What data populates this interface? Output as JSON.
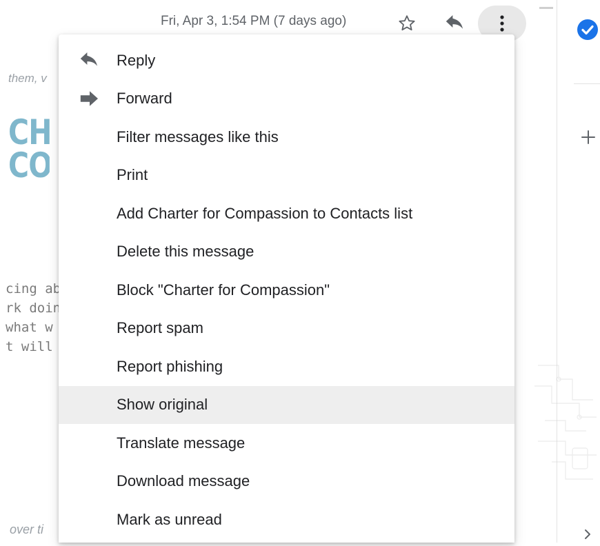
{
  "header": {
    "timestamp": "Fri, Apr 3, 1:54 PM (7 days ago)"
  },
  "icons": {
    "star": "star-outline-icon",
    "reply": "reply-icon",
    "more": "more-vertical-icon",
    "forward": "forward-icon",
    "tasks": "tasks-check-icon",
    "add": "plus-icon",
    "expand": "chevron-right-icon"
  },
  "background": {
    "fragment_top": "them, v",
    "logo_line1": "CH",
    "logo_line2": "CO",
    "body_lines": [
      "cing ab",
      "rk doin",
      " what w",
      "t will l"
    ],
    "fragment_bottom": "over ti"
  },
  "menu": {
    "items": [
      {
        "label": "Reply",
        "icon": "reply-icon"
      },
      {
        "label": "Forward",
        "icon": "forward-icon"
      },
      {
        "label": "Filter messages like this"
      },
      {
        "label": "Print"
      },
      {
        "label": "Add Charter for Compassion to Contacts list"
      },
      {
        "label": "Delete this message"
      },
      {
        "label": "Block \"Charter for Compassion\""
      },
      {
        "label": "Report spam"
      },
      {
        "label": "Report phishing"
      },
      {
        "label": "Show original",
        "highlighted": true
      },
      {
        "label": "Translate message"
      },
      {
        "label": "Download message"
      },
      {
        "label": "Mark as unread"
      }
    ]
  },
  "colors": {
    "highlight": "#eeeeee",
    "tasks_blue": "#1a73e8",
    "text": "#202124",
    "icon_grey": "#5f6368"
  }
}
